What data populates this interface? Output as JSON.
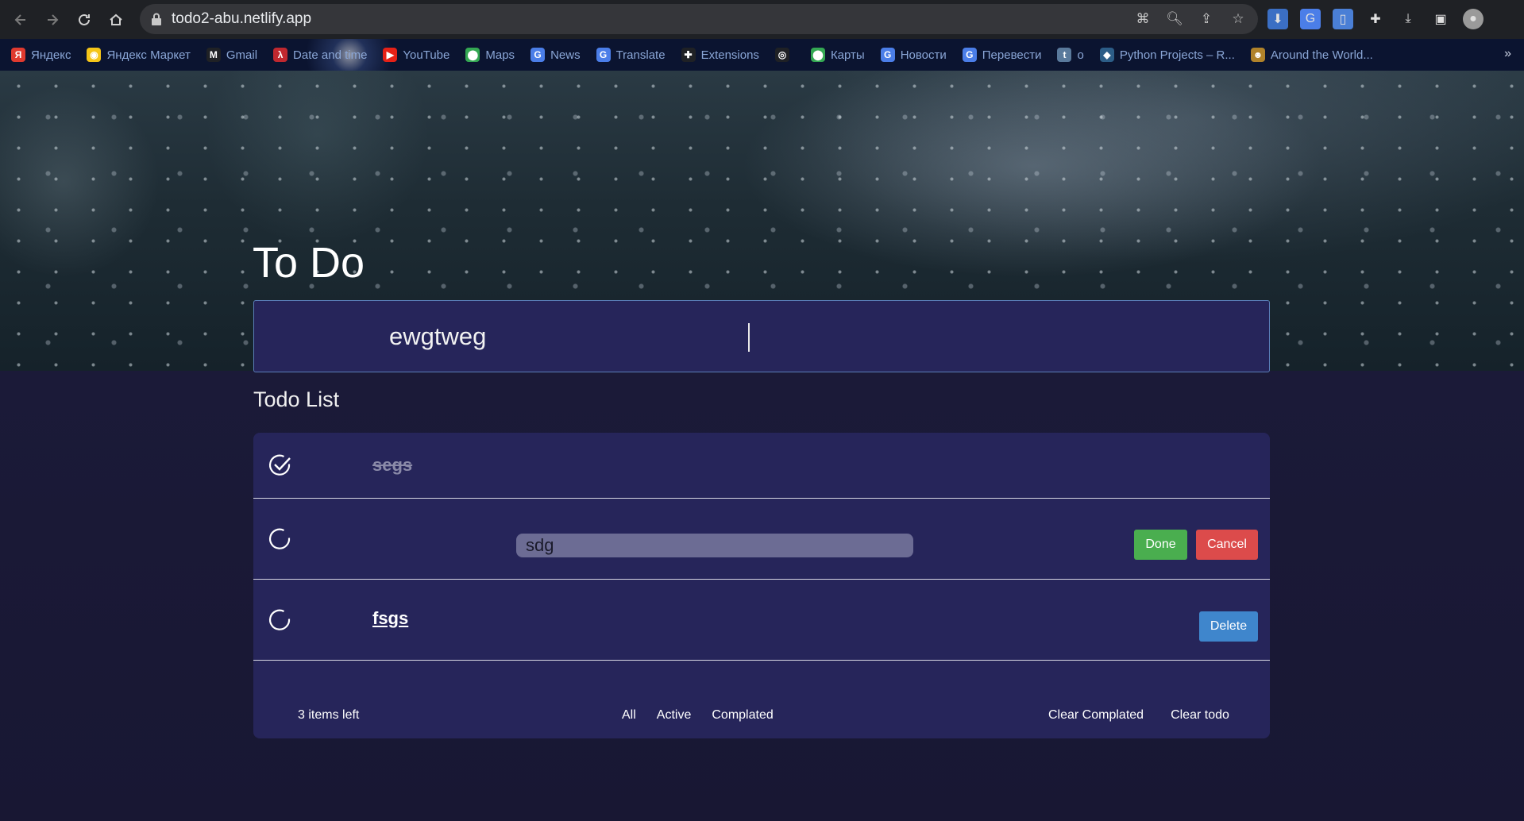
{
  "browser": {
    "url": "todo2-abu.netlify.app",
    "bookmarks": [
      {
        "label": "Яндекс",
        "icon": "yandex-icon",
        "color": "#e03a2f",
        "glyph": "Я"
      },
      {
        "label": "Яндекс Маркет",
        "icon": "yandex-market-icon",
        "color": "#f5c518",
        "glyph": "◉"
      },
      {
        "label": "Gmail",
        "icon": "gmail-icon",
        "color": "#1f2125",
        "glyph": "M"
      },
      {
        "label": "Date and time",
        "icon": "date-icon",
        "color": "#c0282f",
        "glyph": "λ"
      },
      {
        "label": "YouTube",
        "icon": "youtube-icon",
        "color": "#e62117",
        "glyph": "▶"
      },
      {
        "label": "Maps",
        "icon": "maps-icon",
        "color": "#34a853",
        "glyph": "⬤"
      },
      {
        "label": "News",
        "icon": "news-icon",
        "color": "#4b7ee8",
        "glyph": "G"
      },
      {
        "label": "Translate",
        "icon": "translate-icon",
        "color": "#4b7ee8",
        "glyph": "G"
      },
      {
        "label": "Extensions",
        "icon": "extensions-icon",
        "color": "#1f2125",
        "glyph": "✚"
      },
      {
        "label": "",
        "icon": "globe-icon",
        "color": "#1f2125",
        "glyph": "◎"
      },
      {
        "label": "Карты",
        "icon": "maps-icon",
        "color": "#34a853",
        "glyph": "⬤"
      },
      {
        "label": "Новости",
        "icon": "news-icon",
        "color": "#4b7ee8",
        "glyph": "G"
      },
      {
        "label": "Перевести",
        "icon": "translate-icon",
        "color": "#4b7ee8",
        "glyph": "G"
      },
      {
        "label": "o",
        "icon": "tumblr-icon",
        "color": "#5a7a9c",
        "glyph": "t"
      },
      {
        "label": "Python Projects – R...",
        "icon": "python-icon",
        "color": "#2c5d87",
        "glyph": "◆"
      },
      {
        "label": "Around the World...",
        "icon": "around-world-icon",
        "color": "#b0822a",
        "glyph": "☻"
      }
    ],
    "more": "»"
  },
  "app": {
    "title": "To Do",
    "new_todo_value": "ewgtweg",
    "list_heading": "Todo List",
    "todos": [
      {
        "text": "segs",
        "completed": true
      },
      {
        "text": "sdg",
        "completed": false,
        "editing": true
      },
      {
        "text": "fsgs",
        "completed": false
      }
    ],
    "buttons": {
      "done": "Done",
      "cancel": "Cancel",
      "delete": "Delete"
    },
    "footer": {
      "items_left": "3 items left",
      "filters": [
        "All",
        "Active",
        "Complated"
      ],
      "clear_completed": "Clear Complated",
      "clear_todo": "Clear todo"
    }
  },
  "colors": {
    "page_bg": "#1b1a3a",
    "card_bg": "#26255a",
    "done_green": "#4aae4f",
    "cancel_red": "#dc4b4b",
    "delete_blue": "#3f86cc"
  }
}
